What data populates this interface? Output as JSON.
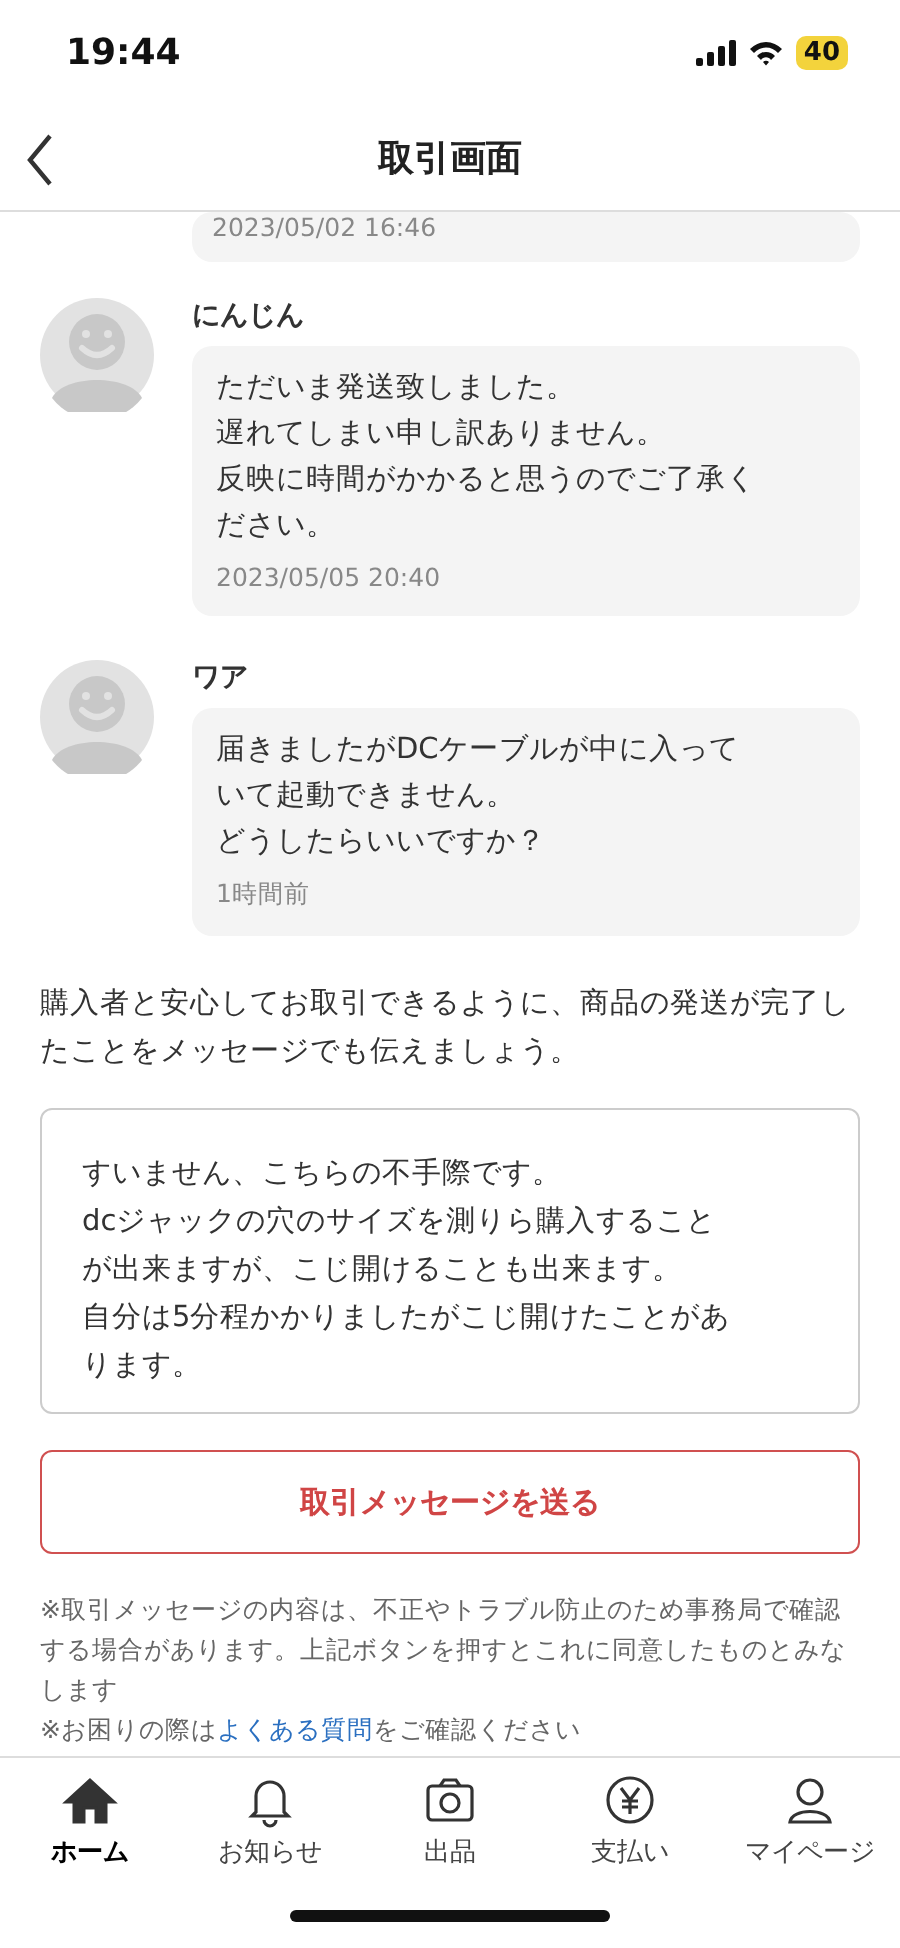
{
  "status_bar": {
    "time": "19:44",
    "battery": "40"
  },
  "header": {
    "title": "取引画面"
  },
  "messages": [
    {
      "kind": "partial",
      "timestamp": "2023/05/02 16:46"
    },
    {
      "kind": "full",
      "name": "にんじん",
      "lines": [
        "ただいま発送致しました。",
        "遅れてしまい申し訳ありません。",
        "反映に時間がかかると思うのでご了承く",
        "ださい。"
      ],
      "timestamp": "2023/05/05 20:40"
    },
    {
      "kind": "full",
      "name": "ワア",
      "lines": [
        "届きましたがDCケーブルが中に入って",
        "いて起動できません。",
        "どうしたらいいですか？"
      ],
      "timestamp": "1時間前"
    }
  ],
  "hint": "購入者と安心してお取引できるように、商品の発送が完了したことをメッセージでも伝えましょう。",
  "message_field": {
    "lines": [
      "すいません、こちらの不手際です。",
      "dcジャックの穴のサイズを測りら購入すること",
      "が出来ますが、こじ開けることも出来ます。",
      "自分は5分程かかりましたがこじ開けたことがあ",
      "ります。"
    ]
  },
  "send_button": "取引メッセージを送る",
  "notes": [
    {
      "kind": "plain",
      "text": "※取引メッセージの内容は、不正やトラブル防止のため事務局で確認する場合があります。上記ボタンを押すとこれに同意したものとみなします"
    },
    {
      "kind": "link",
      "before": "※お困りの際は",
      "link": "よくある質問",
      "after": "をご確認ください"
    }
  ],
  "tabs": [
    {
      "kind": "home",
      "label": "ホーム",
      "selected": true
    },
    {
      "kind": "bell",
      "label": "お知らせ",
      "selected": false
    },
    {
      "kind": "camera",
      "label": "出品",
      "selected": false
    },
    {
      "kind": "yen",
      "label": "支払い",
      "selected": false
    },
    {
      "kind": "user",
      "label": "マイページ",
      "selected": false
    }
  ]
}
